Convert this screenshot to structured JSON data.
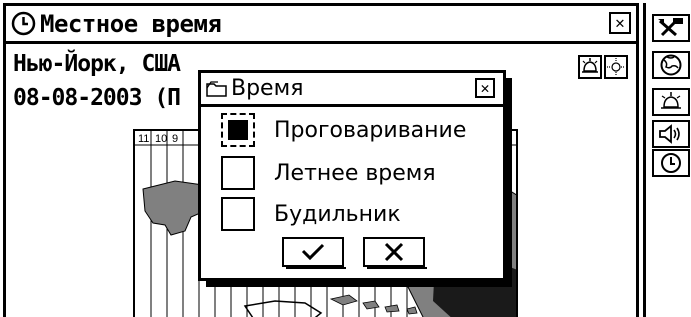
{
  "window": {
    "title": "Местное время",
    "city": "Нью-Йорк, США",
    "date": "08-08-2003 (П"
  },
  "map": {
    "timezones": [
      "11",
      "10",
      "9"
    ]
  },
  "dialog": {
    "title": "Время",
    "options": [
      {
        "label": "Проговаривание",
        "checked": true,
        "focused": true
      },
      {
        "label": "Летнее время",
        "checked": false,
        "focused": false
      },
      {
        "label": "Будильник",
        "checked": false,
        "focused": false
      }
    ],
    "ok_symbol": "✓",
    "cancel_symbol": "✕"
  },
  "toolbar": {
    "tools": [
      "tools-icon",
      "globe-icon",
      "alarm-icon",
      "speaker-icon",
      "clock-icon"
    ]
  },
  "colors": {
    "ink": "#000000",
    "paper": "#ffffff",
    "land": "#808080"
  }
}
